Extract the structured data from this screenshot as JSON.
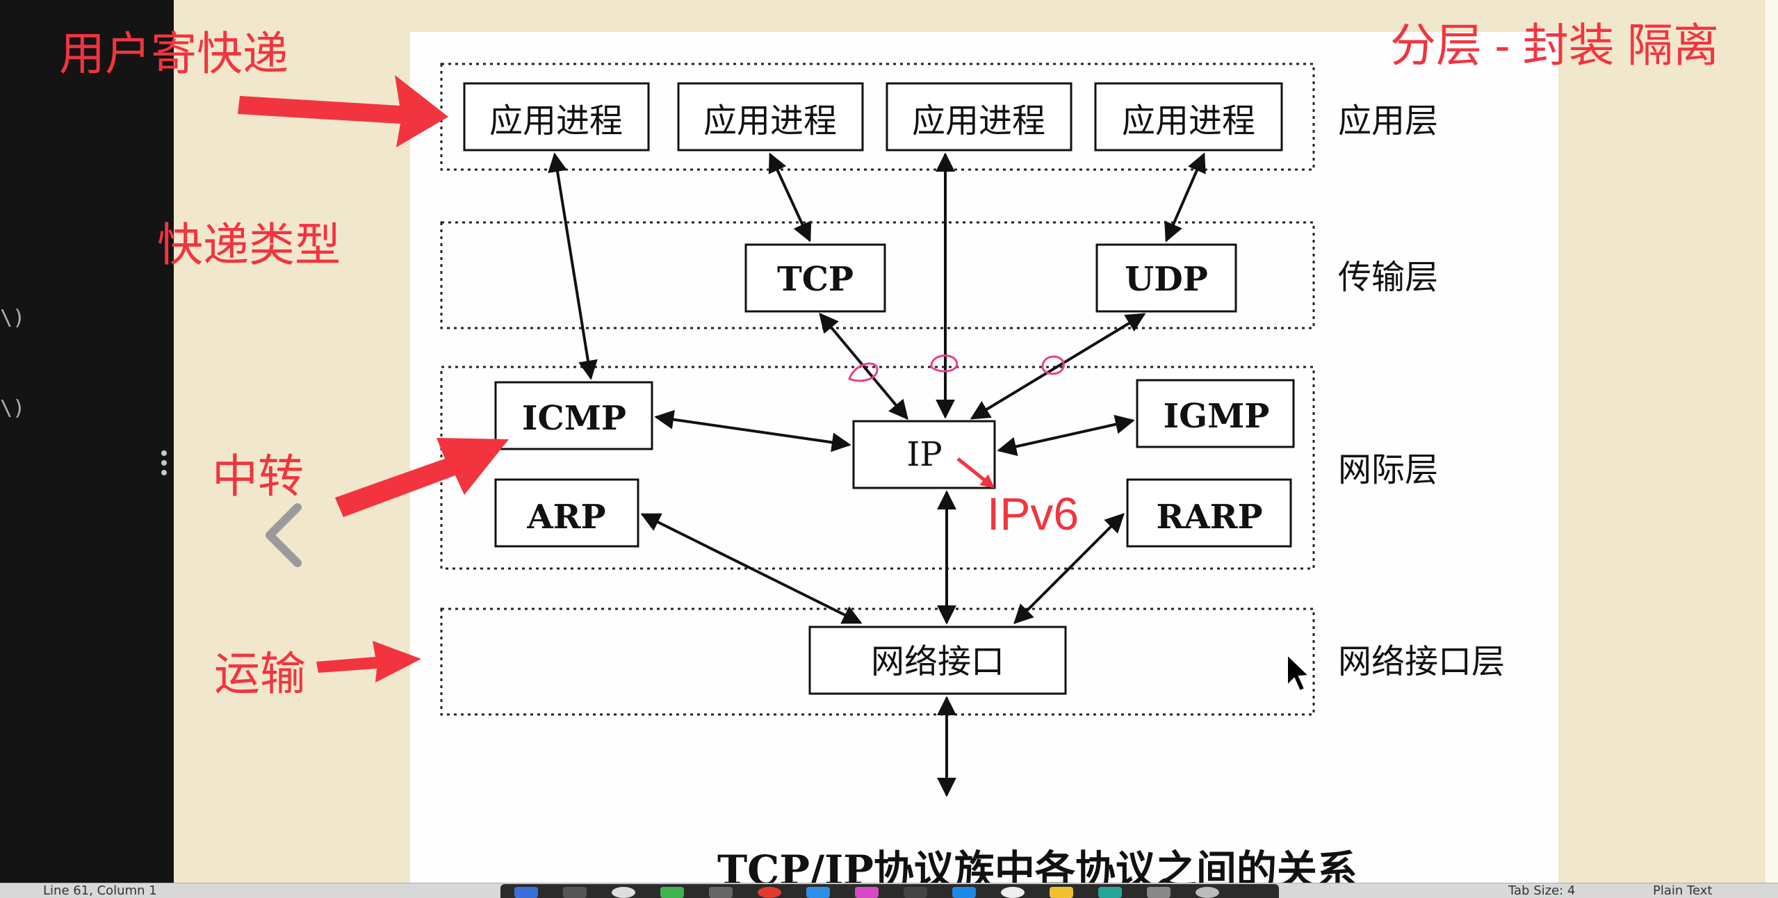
{
  "left_editor": {
    "fragments": [
      "\\)",
      "\\)"
    ]
  },
  "diagram": {
    "layers": {
      "application": "应用层",
      "transport": "传输层",
      "network": "网际层",
      "link": "网络接口层"
    },
    "nodes": {
      "app1": "应用进程",
      "app2": "应用进程",
      "app3": "应用进程",
      "app4": "应用进程",
      "tcp": "TCP",
      "udp": "UDP",
      "icmp": "ICMP",
      "igmp": "IGMP",
      "ip": "IP",
      "arp": "ARP",
      "rarp": "RARP",
      "netif": "网络接口"
    },
    "caption": "TCP/IP协议族中各协议之间的关系"
  },
  "annotations": {
    "top_right": "分层 - 封装 隔离",
    "user_mail": "用户寄快递",
    "express_type": "快递类型",
    "relay": "中转",
    "transport": "运输",
    "ipv6": "IPv6"
  },
  "colors": {
    "annotation_red": "#f2343f",
    "pink_marks": "#e8408a",
    "cursor_chevron": "#9a9a9a"
  },
  "status_bar": {
    "position": "Line 61, Column 1",
    "tab_size": "Tab Size: 4",
    "syntax": "Plain Text"
  }
}
